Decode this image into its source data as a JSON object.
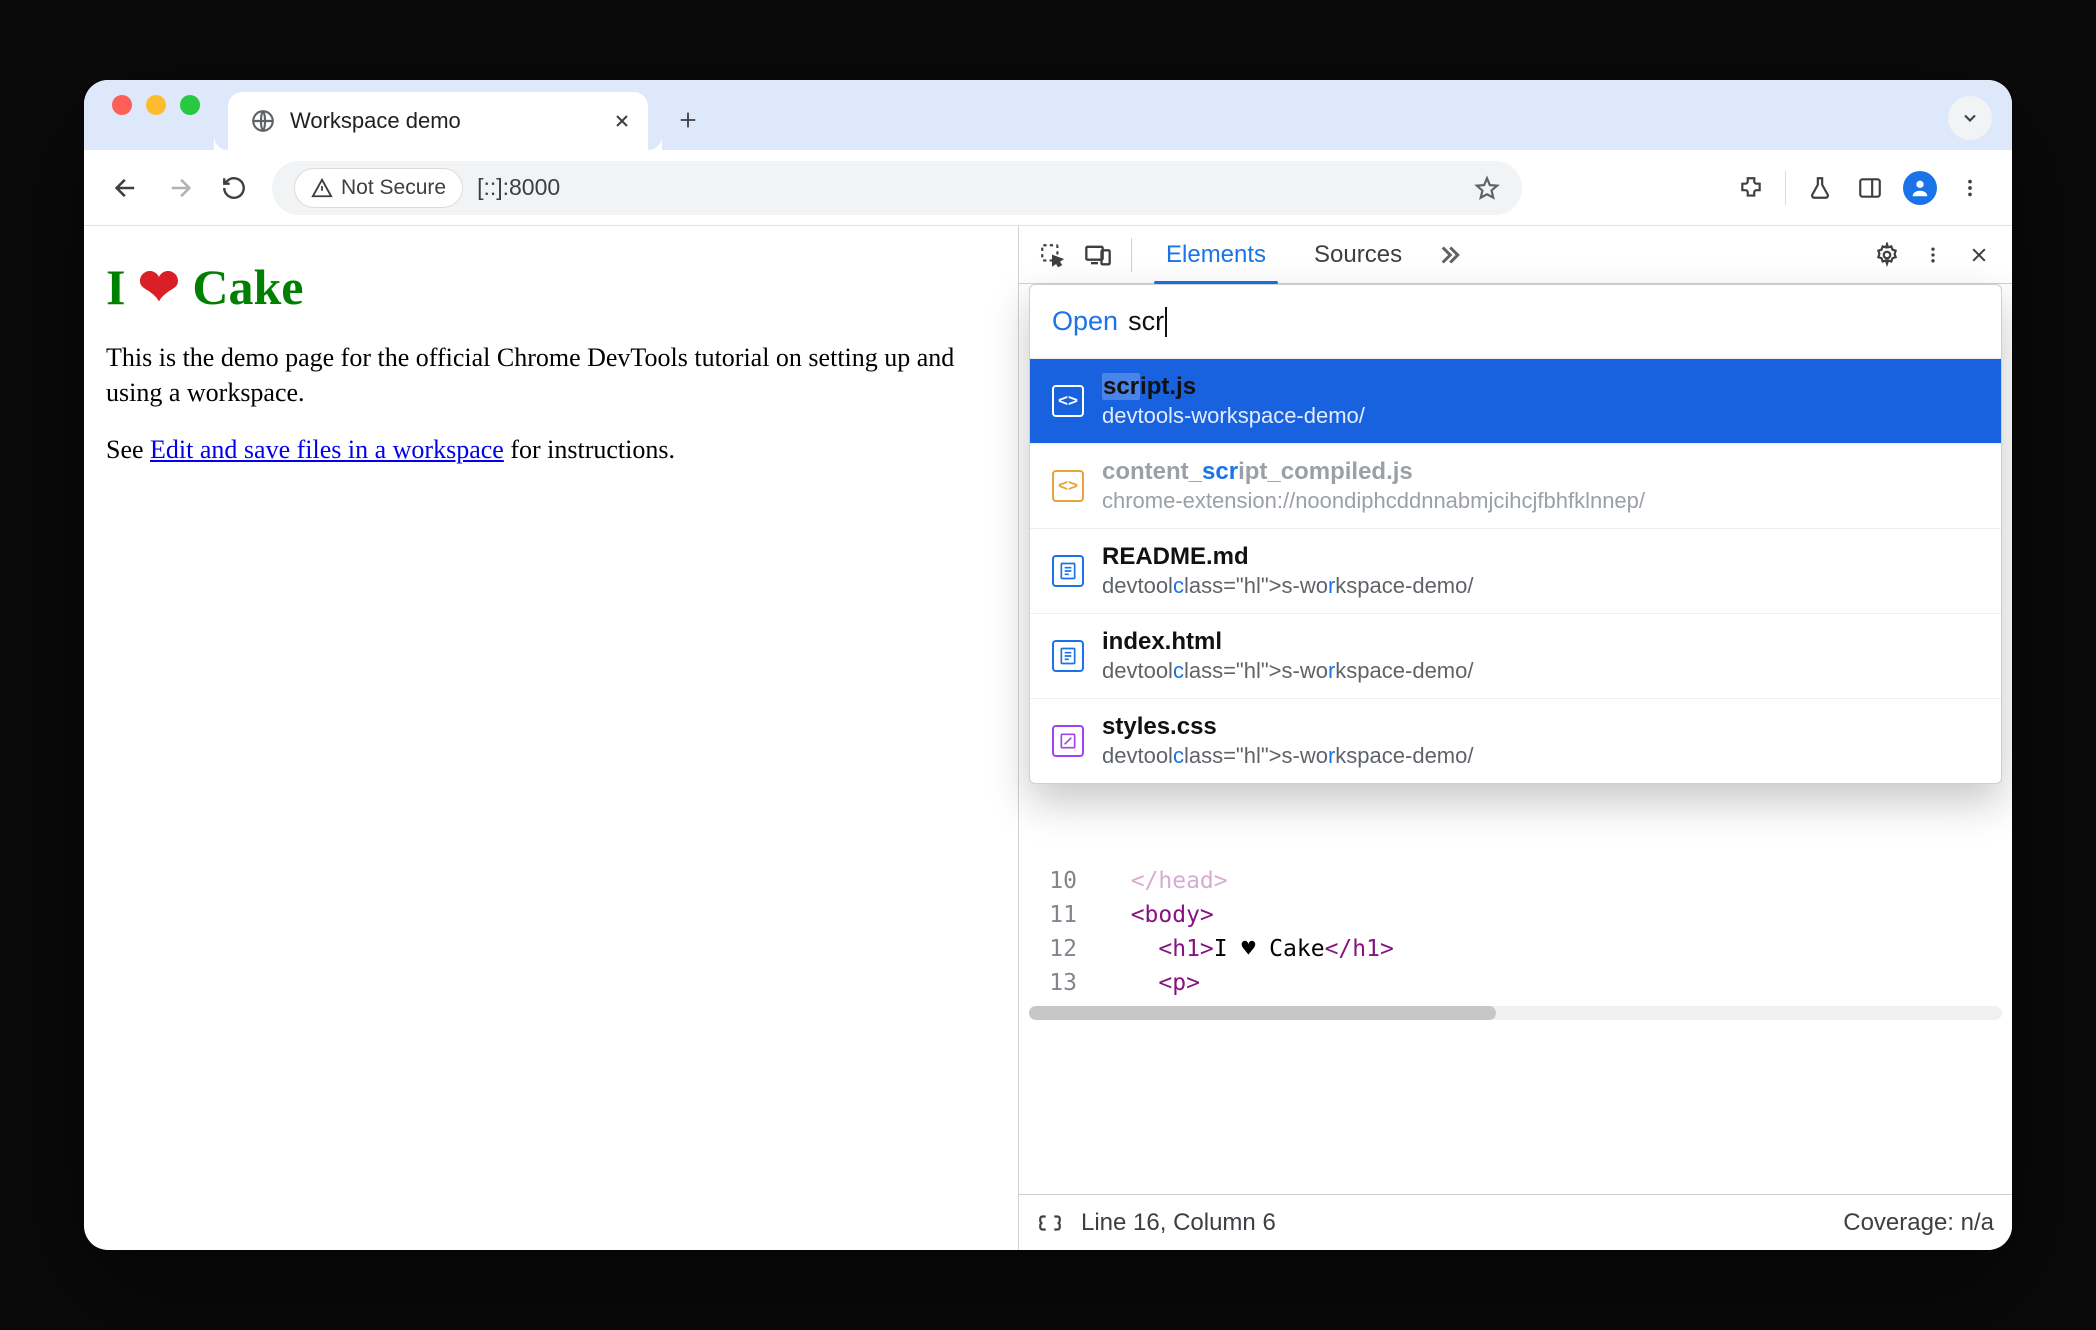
{
  "browser": {
    "tab_title": "Workspace demo",
    "security_label": "Not Secure",
    "url": "[::]:8000"
  },
  "page": {
    "h1_prefix": "I ",
    "h1_heart": "❤",
    "h1_suffix": " Cake",
    "p1": "This is the demo page for the official Chrome DevTools tutorial on setting up and using a workspace.",
    "p2_prefix": "See ",
    "p2_link": "Edit and save files in a workspace",
    "p2_suffix": " for instructions."
  },
  "devtools": {
    "tabs": {
      "elements": "Elements",
      "sources": "Sources"
    },
    "quick_open": {
      "label": "Open",
      "query": "scr",
      "results": [
        {
          "name": "script.js",
          "sub": "devtools-workspace-demo/",
          "icon": "snippet",
          "selected": true,
          "faded": false
        },
        {
          "name": "content_script_compiled.js",
          "sub": "chrome-extension://noondiphcddnnabmjcihcjfbhfklnnep/",
          "icon": "snippet2",
          "selected": false,
          "faded": true
        },
        {
          "name": "README.md",
          "sub": "devtools-workspace-demo/",
          "icon": "doc",
          "selected": false,
          "faded": false
        },
        {
          "name": "index.html",
          "sub": "devtools-workspace-demo/",
          "icon": "doc",
          "selected": false,
          "faded": false
        },
        {
          "name": "styles.css",
          "sub": "devtools-workspace-demo/",
          "icon": "css",
          "selected": false,
          "faded": false
        }
      ]
    },
    "code": {
      "lines": [
        {
          "n": "10",
          "html": "</head>",
          "indent": 1,
          "dim": true
        },
        {
          "n": "11",
          "html_open": "<body>",
          "indent": 1
        },
        {
          "n": "12",
          "html_open": "<h1>",
          "text": "I ♥ Cake",
          "html_close": "</h1>",
          "indent": 2
        },
        {
          "n": "13",
          "html_open": "<p>",
          "indent": 2
        }
      ]
    },
    "status": {
      "pos": "Line 16, Column 6",
      "coverage": "Coverage: n/a"
    }
  }
}
